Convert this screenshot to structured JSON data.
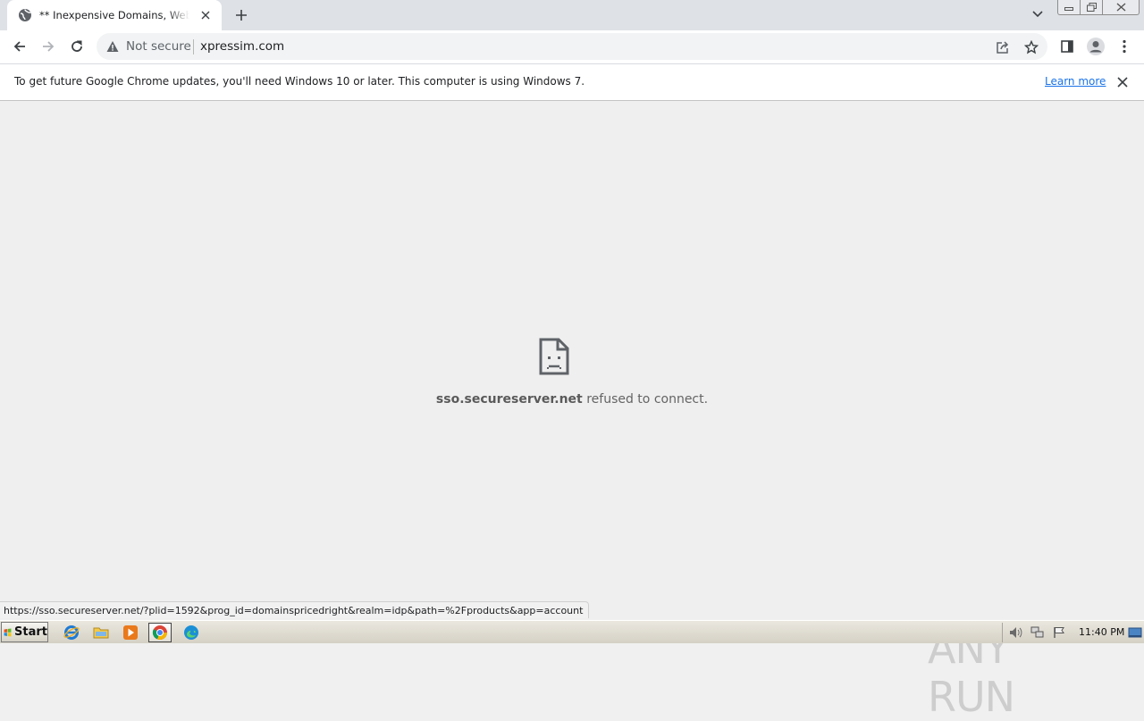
{
  "browser": {
    "tab": {
      "title": "** Inexpensive Domains, Web Hosting, Email Accounts"
    },
    "omnibox": {
      "security_label": "Not secure",
      "url": "xpressim.com"
    }
  },
  "infobar": {
    "message": "To get future Google Chrome updates, you'll need Windows 10 or later. This computer is using Windows 7.",
    "link": "Learn more"
  },
  "error": {
    "host": "sso.secureserver.net",
    "message": " refused to connect."
  },
  "status_url": "https://sso.secureserver.net/?plid=1592&prog_id=domainspricedright&realm=idp&path=%2Fproducts&app=account",
  "watermark": "ANY RUN",
  "taskbar": {
    "start_label": "Start",
    "clock": "11:40 PM",
    "apps": [
      "internet-explorer",
      "windows-explorer",
      "media-player",
      "chrome",
      "edge"
    ]
  },
  "colors": {
    "link": "#1a73e8",
    "chrome_frame": "#dee1e6",
    "page_bg": "#efefef"
  }
}
